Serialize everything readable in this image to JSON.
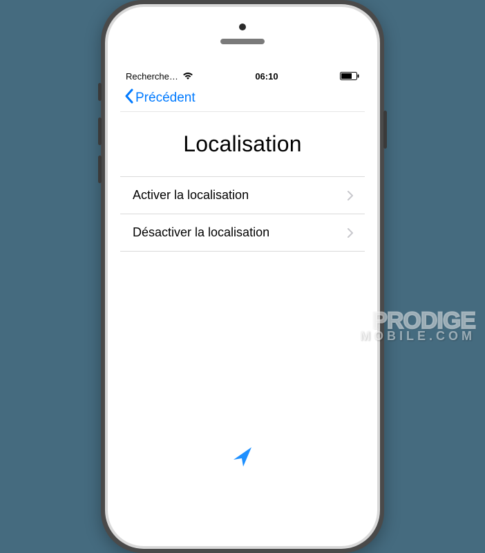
{
  "statusBar": {
    "carrier": "Recherche…",
    "time": "06:10"
  },
  "navBar": {
    "backLabel": "Précédent"
  },
  "page": {
    "title": "Localisation"
  },
  "list": {
    "items": [
      {
        "label": "Activer la localisation"
      },
      {
        "label": "Désactiver la localisation"
      }
    ]
  },
  "watermark": {
    "line1": "PRODIGE",
    "line2": "MOBILE.COM"
  }
}
